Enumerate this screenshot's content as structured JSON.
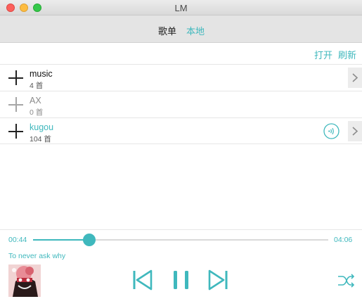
{
  "window": {
    "title": "LM"
  },
  "tabs": [
    {
      "label": "歌单",
      "active": false
    },
    {
      "label": "本地",
      "active": true
    }
  ],
  "toolbar": {
    "open_label": "打开",
    "refresh_label": "刷新"
  },
  "folders": [
    {
      "name": "music",
      "count": "4 首",
      "state": "normal",
      "has_chevron": true,
      "playing": false
    },
    {
      "name": "AX",
      "count": "0 首",
      "state": "disabled",
      "has_chevron": false,
      "playing": false
    },
    {
      "name": "kugou",
      "count": "104 首",
      "state": "active",
      "has_chevron": true,
      "playing": true
    }
  ],
  "player": {
    "current_time": "00:44",
    "total_time": "04:06",
    "progress": 0.19,
    "song_title": "To never ask why"
  },
  "colors": {
    "accent": "#3fb8bd",
    "text": "#222222",
    "muted": "#8a8a8a"
  },
  "icons": {
    "add": "plus-icon",
    "more": "chevron-right-icon",
    "now_playing": "sound-wave-icon",
    "previous": "skip-previous-icon",
    "pause": "pause-icon",
    "next": "skip-next-icon",
    "play_mode": "shuffle-icon"
  }
}
